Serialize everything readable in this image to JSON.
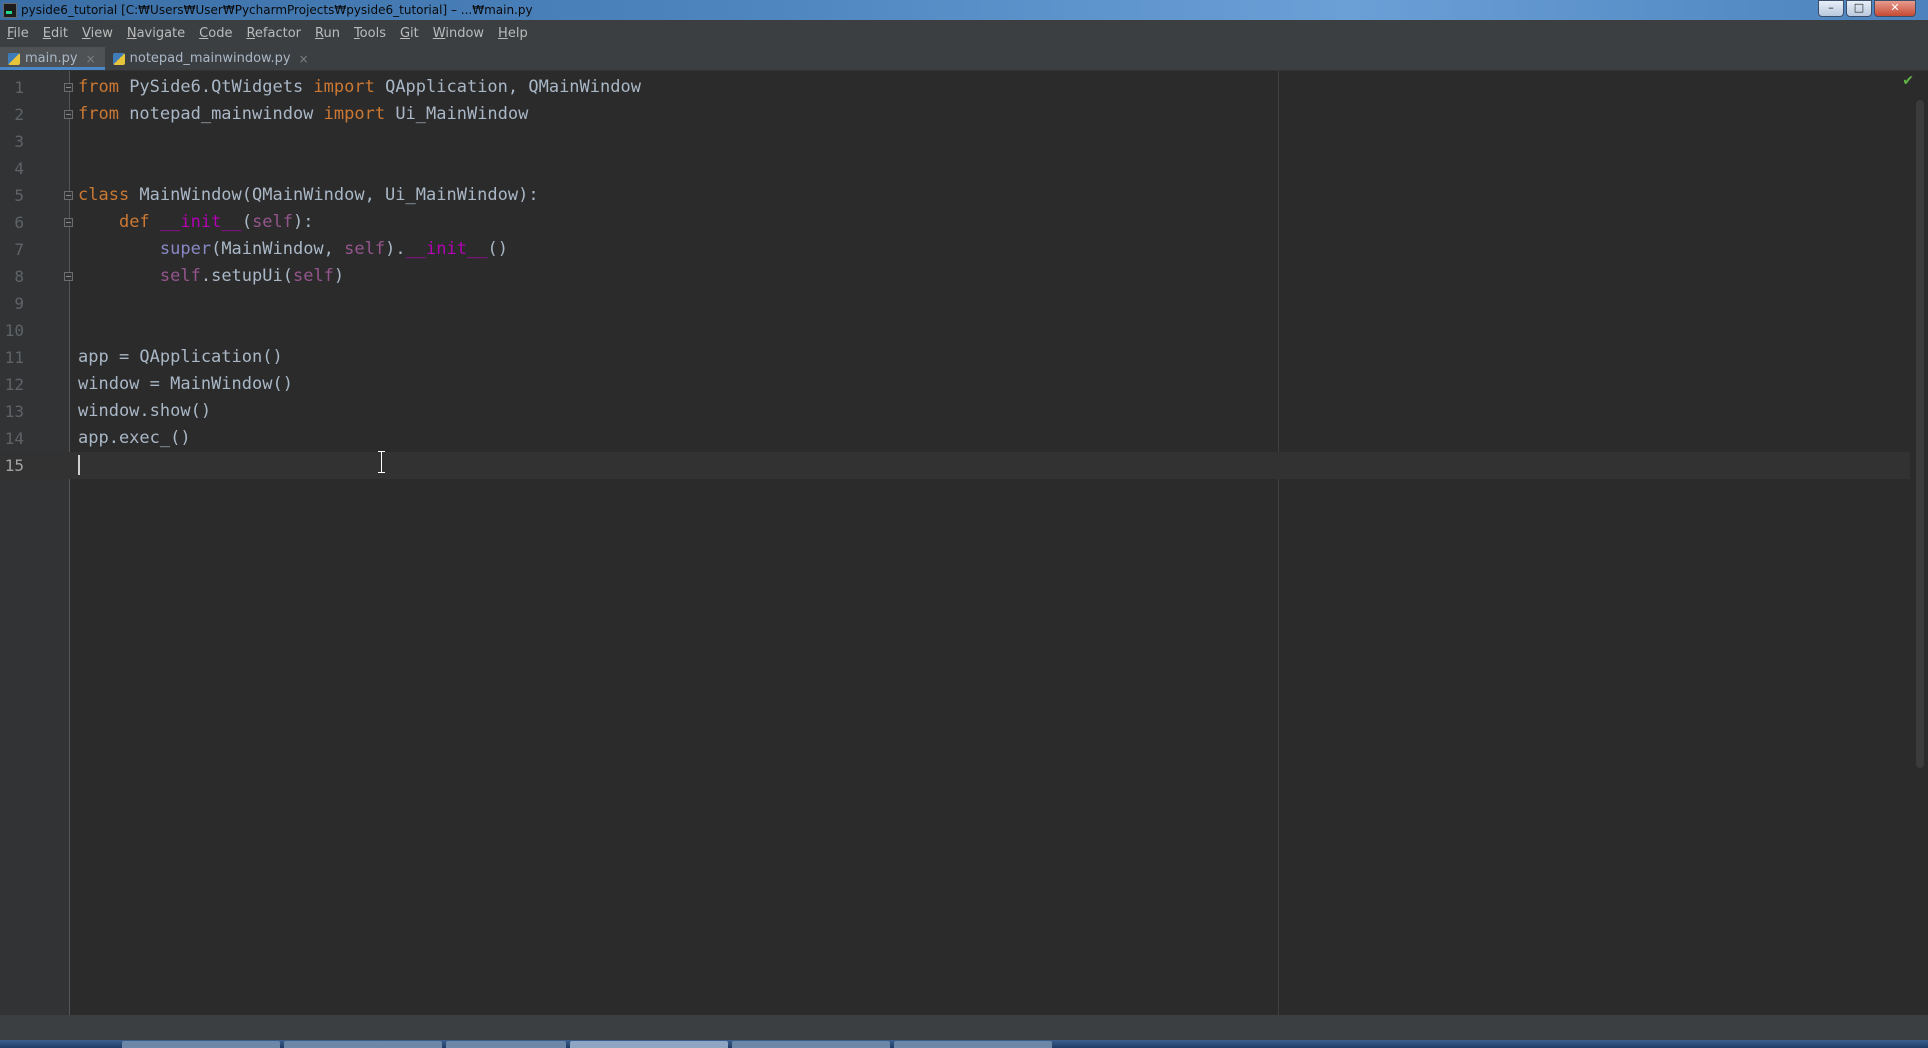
{
  "window": {
    "title": "pyside6_tutorial [C:₩Users₩User₩PycharmProjects₩pyside6_tutorial] – ...₩main.py",
    "controls": {
      "minimize": "–",
      "maximize": "□",
      "close": "✕"
    }
  },
  "menu": [
    "File",
    "Edit",
    "View",
    "Navigate",
    "Code",
    "Refactor",
    "Run",
    "Tools",
    "Git",
    "Window",
    "Help"
  ],
  "tabs": [
    {
      "label": "main.py",
      "active": true,
      "close": "×"
    },
    {
      "label": "notepad_mainwindow.py",
      "active": false,
      "close": "×"
    }
  ],
  "editor": {
    "current_line": "15",
    "line_numbers": [
      "1",
      "2",
      "3",
      "4",
      "5",
      "6",
      "7",
      "8",
      "9",
      "10",
      "11",
      "12",
      "13",
      "14",
      "15"
    ],
    "inspection_icon": "✔",
    "code": {
      "l1": {
        "kw1": "from",
        "mod": " PySide6.QtWidgets ",
        "kw2": "import",
        "rest": " QApplication, QMainWindow"
      },
      "l2": {
        "kw1": "from",
        "mod": " notepad_mainwindow ",
        "kw2": "import",
        "rest": " Ui_MainWindow"
      },
      "l5": {
        "kw": "class",
        "rest": " MainWindow(QMainWindow, Ui_MainWindow):"
      },
      "l6": {
        "indent": "    ",
        "kw": "def",
        "sp": " ",
        "fn": "__init__",
        "open": "(",
        "self": "self",
        "close": "):"
      },
      "l7": {
        "indent": "        ",
        "bi": "super",
        "a": "(MainWindow, ",
        "self": "self",
        "b": ").",
        "fn": "__init__",
        "c": "()"
      },
      "l8": {
        "indent": "        ",
        "self1": "self",
        "a": ".setupUi(",
        "self2": "self",
        "b": ")"
      },
      "l11": "app = QApplication()",
      "l12": "window = MainWindow()",
      "l13": "window.show()",
      "l14": "app.exec_()"
    }
  },
  "colors": {
    "editor_bg": "#2b2b2b",
    "keyword": "#cc7832",
    "magic_method": "#b200b2",
    "self": "#94558d",
    "builtin": "#8888c6",
    "text": "#a9b7c6"
  }
}
